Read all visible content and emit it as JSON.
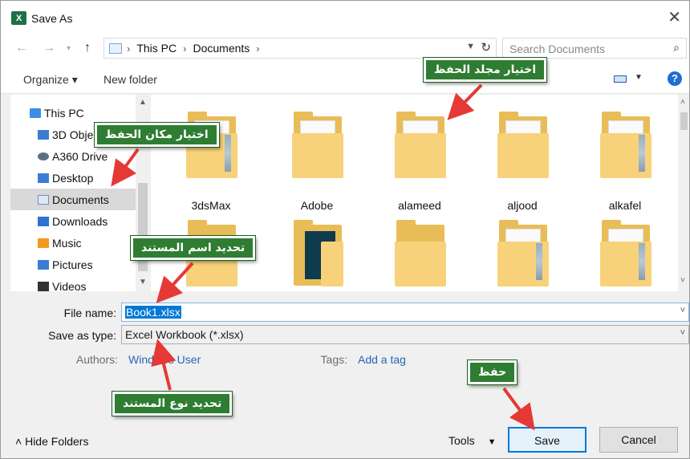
{
  "window": {
    "title": "Save As",
    "app_icon": "X"
  },
  "address": {
    "segments": [
      "This PC",
      "Documents"
    ]
  },
  "search": {
    "placeholder": "Search Documents"
  },
  "toolbar": {
    "organize": "Organize ▾",
    "new_folder": "New folder"
  },
  "navpane": {
    "items": [
      {
        "label": "This PC",
        "icon": "computer-icon"
      },
      {
        "label": "3D Obje",
        "icon": "3d-objects-icon"
      },
      {
        "label": "A360 Drive",
        "icon": "cloud-drive-icon"
      },
      {
        "label": "Desktop",
        "icon": "desktop-icon"
      },
      {
        "label": "Documents",
        "icon": "documents-icon",
        "selected": true
      },
      {
        "label": "Downloads",
        "icon": "downloads-icon"
      },
      {
        "label": "Music",
        "icon": "music-icon"
      },
      {
        "label": "Pictures",
        "icon": "pictures-icon"
      },
      {
        "label": "Videos",
        "icon": "videos-icon"
      }
    ]
  },
  "folders": [
    {
      "name": "3dsMax"
    },
    {
      "name": "Adobe"
    },
    {
      "name": "alameed"
    },
    {
      "name": "aljood"
    },
    {
      "name": "alkafel"
    }
  ],
  "form": {
    "file_name_label": "File name:",
    "file_name_value": "Book1.xlsx",
    "type_label": "Save as type:",
    "type_value": "Excel Workbook (*.xlsx)",
    "authors_label": "Authors:",
    "authors_value": "Windows User",
    "tags_label": "Tags:",
    "tags_value": "Add a tag"
  },
  "footer": {
    "hide_folders": "Hide Folders",
    "tools": "Tools",
    "save": "Save",
    "cancel": "Cancel"
  },
  "annotations": {
    "choose_folder": "اختيار مجلد الحفظ",
    "choose_location": "اختيار مكان الحفظ",
    "set_name": "تحديد اسم المستند",
    "set_type": "تحديد نوع المستند",
    "save": "حفظ"
  },
  "colors": {
    "annotation_bg": "#2e7d32",
    "arrow": "#e53935",
    "selection": "#0078d7"
  }
}
